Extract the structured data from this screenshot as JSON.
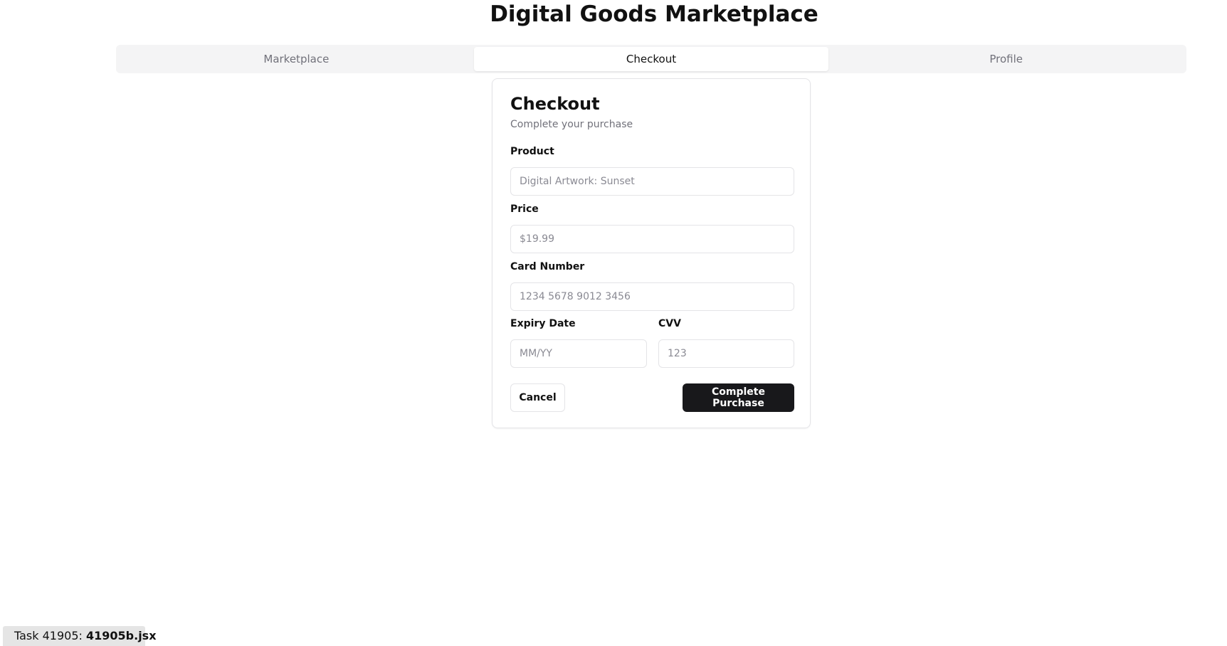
{
  "app": {
    "title": "Digital Goods Marketplace"
  },
  "tabs": [
    {
      "label": "Marketplace",
      "active": false
    },
    {
      "label": "Checkout",
      "active": true
    },
    {
      "label": "Profile",
      "active": false
    }
  ],
  "checkout": {
    "title": "Checkout",
    "subtitle": "Complete your purchase",
    "fields": {
      "product": {
        "label": "Product",
        "placeholder": "Digital Artwork: Sunset",
        "value": ""
      },
      "price": {
        "label": "Price",
        "placeholder": "$19.99",
        "value": ""
      },
      "card_number": {
        "label": "Card Number",
        "placeholder": "1234 5678 9012 3456",
        "value": ""
      },
      "expiry": {
        "label": "Expiry Date",
        "placeholder": "MM/YY",
        "value": ""
      },
      "cvv": {
        "label": "CVV",
        "placeholder": "123",
        "value": ""
      }
    },
    "cancel_label": "Cancel",
    "submit_label": "Complete Purchase"
  },
  "footer": {
    "task_prefix": "Task 41905: ",
    "task_file": "41905b.jsx"
  },
  "colors": {
    "primary_button": "#18181b",
    "tab_bar_background": "#f4f4f5",
    "muted_text": "#71717a",
    "border": "#e4e4e7"
  }
}
